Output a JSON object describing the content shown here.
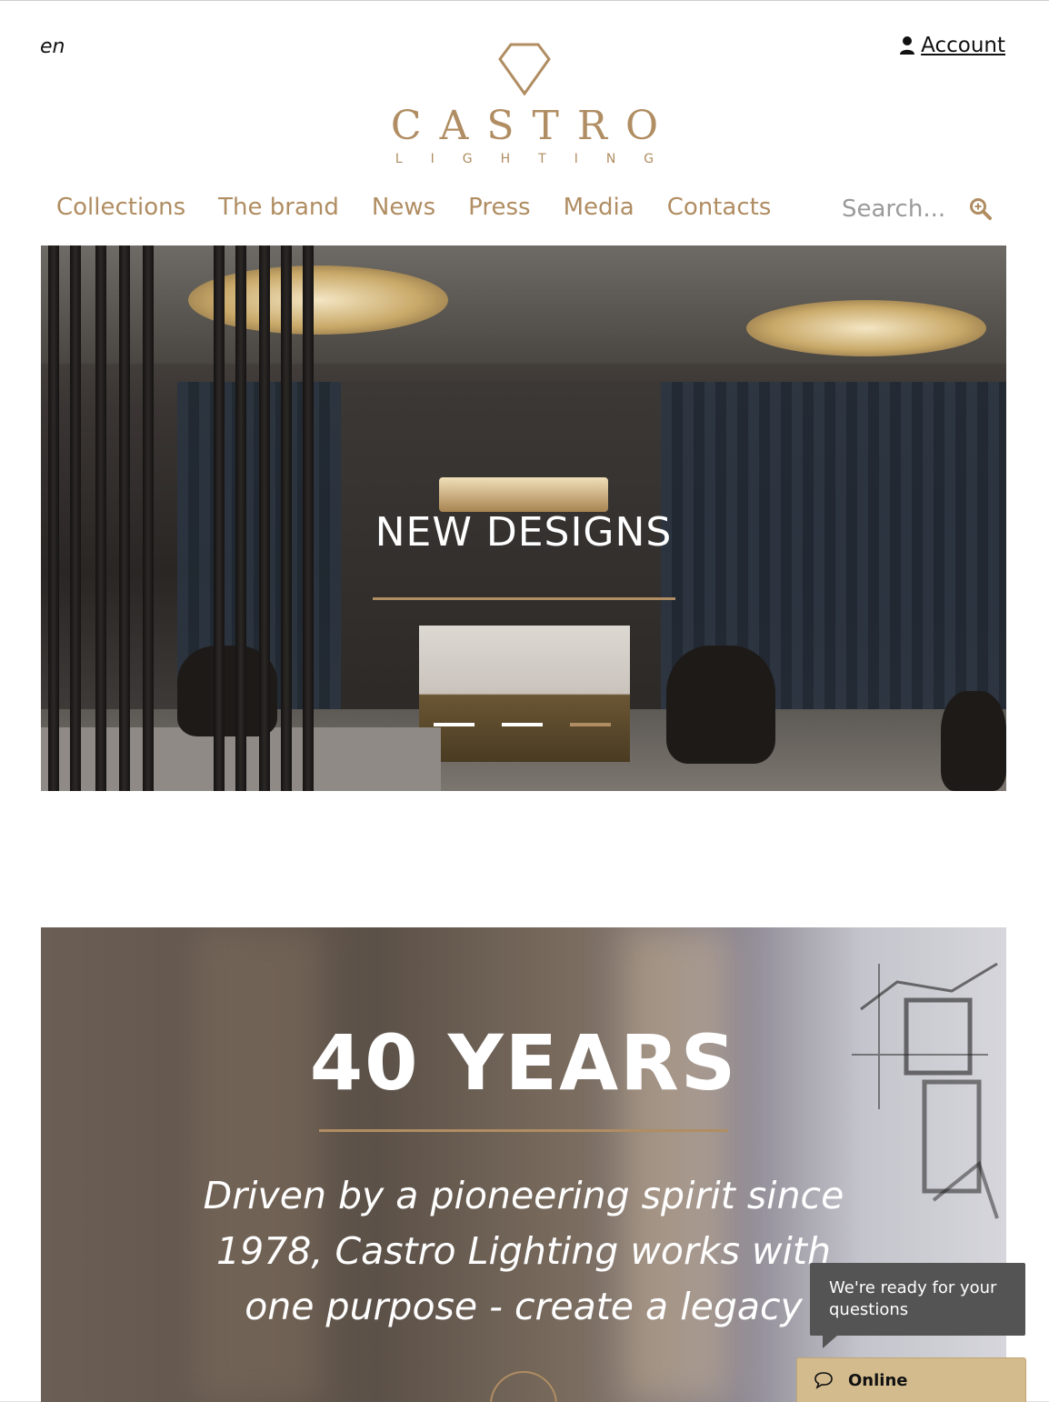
{
  "header": {
    "language": "en",
    "account_label": "Account",
    "logo": {
      "brand": "CASTRO",
      "sub": "LIGHTING"
    }
  },
  "nav": {
    "items": [
      "Collections",
      "The brand",
      "News",
      "Press",
      "Media",
      "Contacts"
    ],
    "search_placeholder": "Search..."
  },
  "hero": {
    "title": "NEW DESIGNS",
    "slides": 3,
    "active_slide": 3
  },
  "years_section": {
    "title": "40 YEARS",
    "text": "Driven by a pioneering spirit since 1978, Castro Lighting works with one purpose - create a legacy"
  },
  "chat": {
    "prompt": "We're ready for your questions",
    "status": "Online"
  },
  "colors": {
    "accent": "#b08d62",
    "chat_bubble": "#555454",
    "chat_bar": "#d3bb8e"
  }
}
